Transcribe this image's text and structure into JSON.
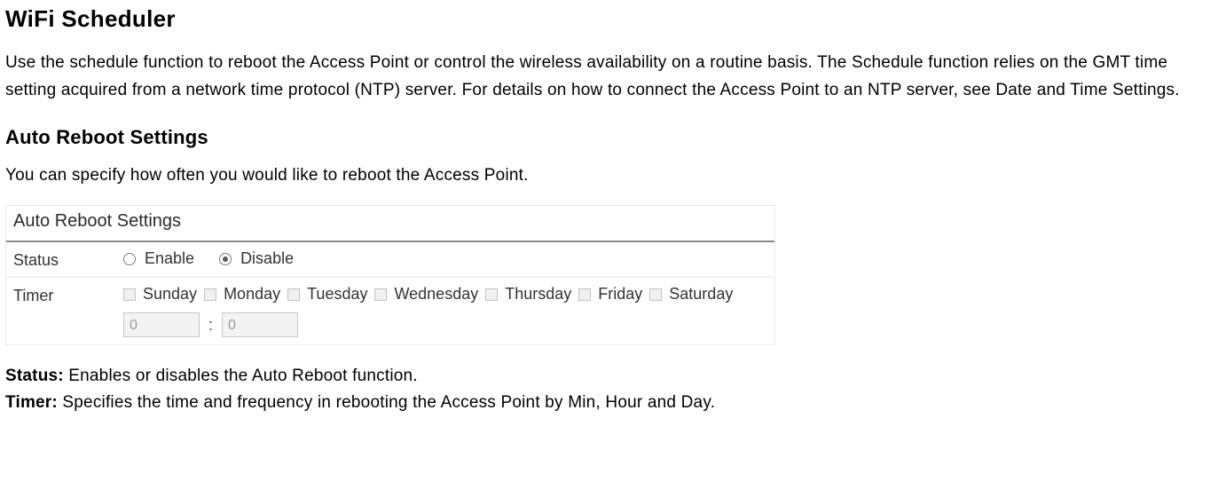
{
  "title": "WiFi Scheduler",
  "intro": "Use the schedule function to reboot the Access Point or control the wireless availability on a routine basis. The Schedule function relies on the GMT time setting acquired from a network time protocol (NTP) server. For details on how to connect the Access Point to an NTP server, see Date and Time Settings.",
  "section": {
    "title": "Auto Reboot Settings",
    "desc": "You can specify how often you would like to reboot the Access Point."
  },
  "panel": {
    "title": "Auto Reboot Settings",
    "status": {
      "label": "Status",
      "enable": "Enable",
      "disable": "Disable",
      "selected": "disable"
    },
    "timer": {
      "label": "Timer",
      "days": [
        "Sunday",
        "Monday",
        "Tuesday",
        "Wednesday",
        "Thursday",
        "Friday",
        "Saturday"
      ],
      "hour": "0",
      "minute": "0"
    }
  },
  "defs": {
    "status_term": "Status:",
    "status_text": " Enables or disables the Auto Reboot function.",
    "timer_term": "Timer:",
    "timer_text": " Specifies the time and frequency in rebooting the Access Point by Min, Hour and Day."
  }
}
